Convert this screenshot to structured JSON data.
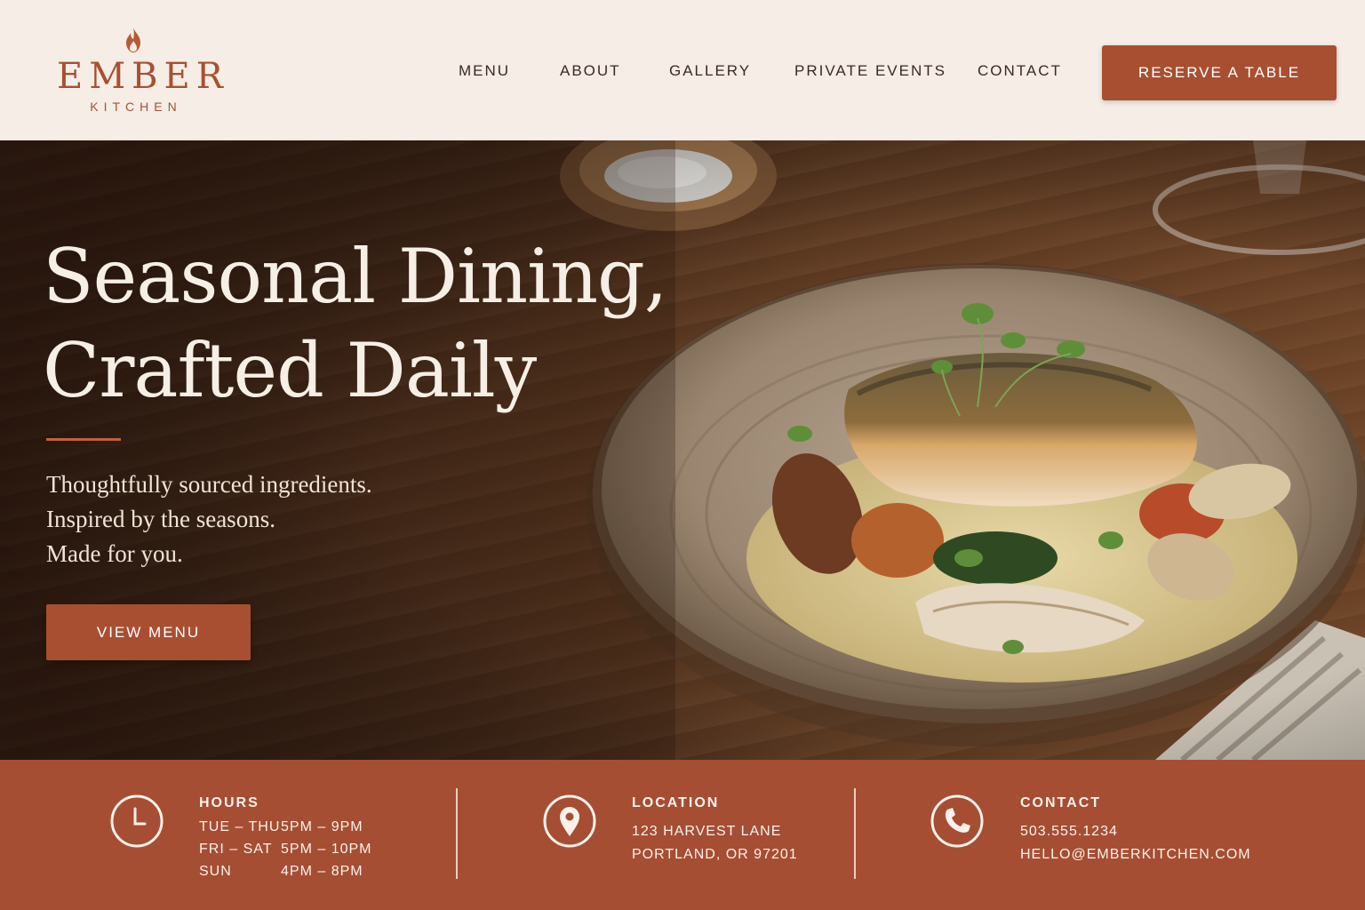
{
  "brand": {
    "name": "EMBER",
    "subtitle": "KITCHEN",
    "icon": "flame-icon"
  },
  "nav": {
    "items": [
      "MENU",
      "ABOUT",
      "GALLERY",
      "PRIVATE EVENTS",
      "CONTACT"
    ],
    "cta_label": "RESERVE A TABLE"
  },
  "hero": {
    "title_lines": [
      "Seasonal Dining,",
      "Crafted Daily"
    ],
    "tagline_lines": [
      "Thoughtfully sourced ingredients.",
      "Inspired by the seasons.",
      "Made for you."
    ],
    "cta_label": "VIEW MENU"
  },
  "info": {
    "hours": {
      "icon": "clock-icon",
      "heading": "HOURS",
      "rows": [
        {
          "days": "TUE – THU",
          "time": "5PM – 9PM"
        },
        {
          "days": "FRI – SAT",
          "time": "5PM – 10PM"
        },
        {
          "days": "SUN",
          "time": "4PM – 8PM"
        }
      ]
    },
    "location": {
      "icon": "map-pin-icon",
      "heading": "LOCATION",
      "lines": [
        "123 HARVEST LANE",
        "PORTLAND, OR 97201"
      ]
    },
    "contact": {
      "icon": "phone-icon",
      "heading": "CONTACT",
      "lines": [
        "503.555.1234",
        "HELLO@EMBERKITCHEN.COM"
      ]
    }
  },
  "colors": {
    "accent": "#a84f32",
    "header_bg": "#f5ede6",
    "info_bg": "#a54e33",
    "text_dark": "#3a2a22"
  }
}
